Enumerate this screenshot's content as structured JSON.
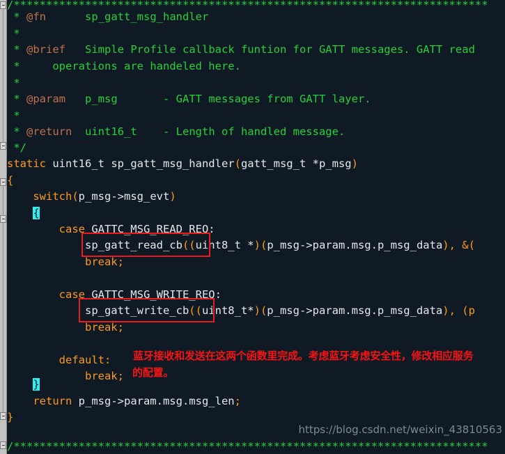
{
  "editor": {
    "language": "c",
    "background_color": "#101a24",
    "gutter_color": "#c3c3c3",
    "colors": {
      "comment": "#24d13b",
      "doc_tag": "#c0714d",
      "keyword": "#ff9a18",
      "identifier": "#e3e8ec",
      "punctuation": "#ff9a18",
      "brace_match_bg": "#2ff0f0",
      "annotation_red": "#f51414"
    }
  },
  "code_lines": [
    {
      "id": "line-banner-top",
      "text": "/*************************************************************************"
    },
    {
      "id": "line-fn",
      "text": " * @fn       sp_gatt_msg_handler"
    },
    {
      "id": "line-blank-1",
      "text": " *"
    },
    {
      "id": "line-brief",
      "text": " * @brief   Simple Profile callback funtion for GATT messages. GATT read"
    },
    {
      "id": "line-brief-cont",
      "text": " *     operations are handeled here."
    },
    {
      "id": "line-blank-2",
      "text": " *"
    },
    {
      "id": "line-param",
      "text": " * @param   p_msg       - GATT messages from GATT layer."
    },
    {
      "id": "line-blank-3",
      "text": " *"
    },
    {
      "id": "line-return",
      "text": " * @return  uint16_t    - Length of handled message."
    },
    {
      "id": "line-comment-end",
      "text": " */"
    },
    {
      "id": "line-signature",
      "text": "static uint16_t sp_gatt_msg_handler(gatt_msg_t *p_msg)"
    },
    {
      "id": "line-func-open",
      "text": "{"
    },
    {
      "id": "line-switch",
      "text": "    switch(p_msg->msg_evt)"
    },
    {
      "id": "line-switch-open",
      "text": "    {"
    },
    {
      "id": "line-case-read",
      "text": "        case GATTC_MSG_READ_REQ:"
    },
    {
      "id": "line-read-cb",
      "text": "            sp_gatt_read_cb((uint8_t *)(p_msg->param.msg.p_msg_data), &("
    },
    {
      "id": "line-break-read",
      "text": "            break;"
    },
    {
      "id": "line-blank-4",
      "text": ""
    },
    {
      "id": "line-case-write",
      "text": "        case GATTC_MSG_WRITE_REQ:"
    },
    {
      "id": "line-write-cb",
      "text": "            sp_gatt_write_cb((uint8_t*)(p_msg->param.msg.p_msg_data), (p"
    },
    {
      "id": "line-break-write",
      "text": "            break;"
    },
    {
      "id": "line-blank-5",
      "text": ""
    },
    {
      "id": "line-default",
      "text": "        default:"
    },
    {
      "id": "line-break-default",
      "text": "            break;"
    },
    {
      "id": "line-switch-close",
      "text": "    }"
    },
    {
      "id": "line-return-stmt",
      "text": "    return p_msg->param.msg.msg_len;"
    },
    {
      "id": "line-func-close",
      "text": "}"
    },
    {
      "id": "line-blank-6",
      "text": ""
    },
    {
      "id": "line-banner-bottom",
      "text": "/*************************************************************************"
    }
  ],
  "tokens": {
    "banner_top": "/*************************************************************************",
    "banner_bottom": "/*************************************************************************",
    "star": " *",
    "tag_fn": "@fn",
    "fn_name": "sp_gatt_msg_handler",
    "tag_brief": "@brief",
    "brief_text": "Simple Profile callback funtion for GATT messages. GATT read",
    "brief_cont": "operations are handeled here.",
    "tag_param": "@param",
    "param_text": "p_msg       - GATT messages from GATT layer.",
    "tag_return": "@return",
    "return_text": "uint16_t    - Length of handled message.",
    "comment_close": " */",
    "kw_static": "static",
    "sig_type": " uint16_t sp_gatt_msg_handler",
    "sig_open": "(",
    "sig_args": "gatt_msg_t *p_msg",
    "sig_close": ")",
    "brace_open_func": "{",
    "kw_switch": "switch",
    "switch_expr_open": "(",
    "switch_expr": "p_msg->msg_evt",
    "switch_expr_close": ")",
    "brace_open_switch": "{",
    "kw_case": "case",
    "case_read_label": " GATTC_MSG_READ_REQ:",
    "call_read": "sp_gatt_read_cb",
    "read_args_open": "((",
    "read_args_a": "uint8_t *",
    "read_args_mid": ")(",
    "read_args_b": "p_msg->param.msg.p_msg_data",
    "read_args_tail": "), &(",
    "kw_break": "break",
    "semi": ";",
    "case_write_label": " GATTC_MSG_WRITE_REQ:",
    "call_write": "sp_gatt_write_cb",
    "write_args_open": "((",
    "write_args_a": "uint8_t*",
    "write_args_mid": ")(",
    "write_args_b": "p_msg->param.msg.p_msg_data",
    "write_args_tail": "), (p",
    "kw_default": "default",
    "colon": ":",
    "brace_close_switch": "}",
    "kw_return": "return",
    "return_expr": " p_msg->param.msg.msg_len",
    "brace_close_func": "}"
  },
  "annotations": {
    "box_read_label": "highlight-sp-gatt-read-cb",
    "box_write_label": "highlight-sp-gatt-write-cb",
    "note_line_1": "蓝牙接收和发送在这两个函数里完成。考虑蓝牙考虑安全性，修改相应服务",
    "note_line_2": "的配置。"
  },
  "watermark": {
    "text": "https://blog.csdn.net/weixin_43810563"
  }
}
